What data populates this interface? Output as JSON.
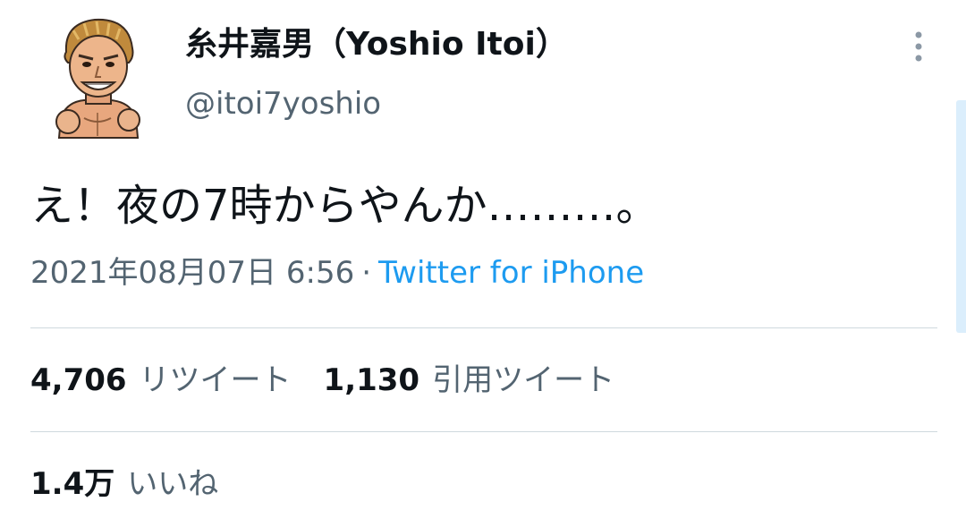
{
  "author": {
    "display_name": "糸井嘉男（Yoshio Itoi）",
    "handle": "@itoi7yoshio"
  },
  "tweet": {
    "text": "え！夜の7時からやんか………。",
    "timestamp": "2021年08月07日 6:56",
    "separator": "·",
    "source": "Twitter for iPhone"
  },
  "stats": {
    "retweets": {
      "count": "4,706",
      "label": "リツイート"
    },
    "quotes": {
      "count": "1,130",
      "label": "引用ツイート"
    },
    "likes": {
      "count": "1.4万",
      "label": "いいね"
    }
  },
  "icons": {
    "more": "more-vertical-icon",
    "avatar": "cartoon-avatar"
  },
  "colors": {
    "primary_text": "#0f1419",
    "secondary_text": "#536471",
    "link": "#1d9bf0",
    "divider": "#cfd9de"
  }
}
